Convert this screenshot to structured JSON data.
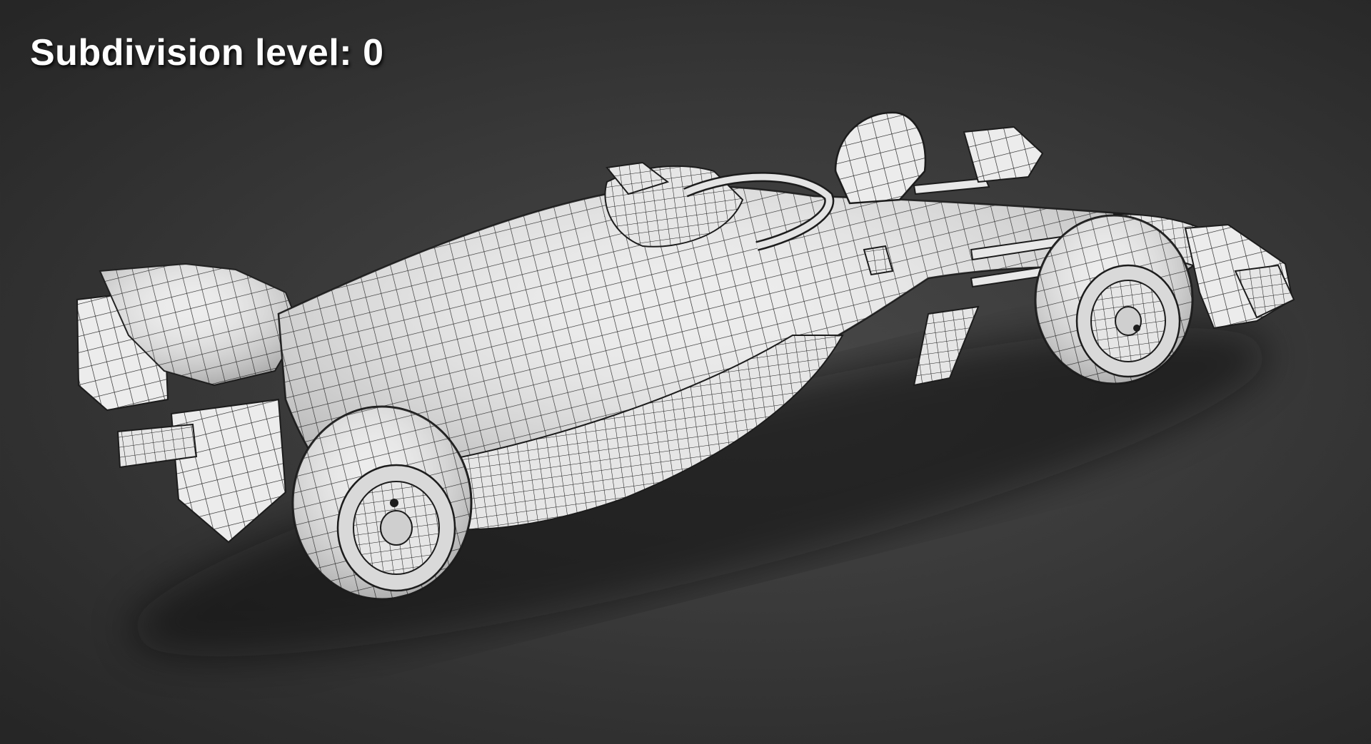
{
  "overlay": {
    "label_prefix": "Subdivision level:",
    "subdivision_level": "0"
  },
  "scene": {
    "subject": "formula-one-car-wireframe",
    "background_color": "#3a3a3a",
    "surface_color": "#ececec",
    "wire_color": "#1c1c1c"
  }
}
